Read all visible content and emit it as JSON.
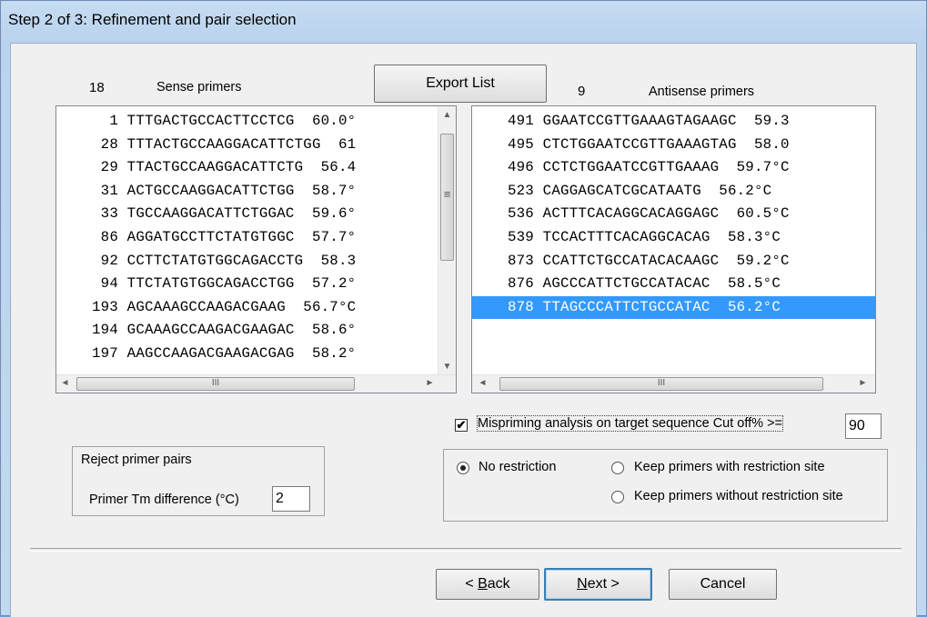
{
  "window": {
    "title": "Step 2 of 3:  Refinement and pair selection"
  },
  "sense": {
    "count": "18",
    "label": "Sense primers",
    "rows": [
      "1 TTTGACTGCCACTTCCTCG  60.0°",
      "28 TTTACTGCCAAGGACATTCTGG  61",
      "29 TTACTGCCAAGGACATTCTG  56.4",
      "31 ACTGCCAAGGACATTCTGG  58.7°",
      "33 TGCCAAGGACATTCTGGAC  59.6°",
      "86 AGGATGCCTTCTATGTGGC  57.7°",
      "92 CCTTCTATGTGGCAGACCTG  58.3",
      "94 TTCTATGTGGCAGACCTGG  57.2°",
      "193 AGCAAAGCCAAGACGAAG  56.7°C",
      "194 GCAAAGCCAAGACGAAGAC  58.6°",
      "197 AAGCCAAGACGAAGACGAG  58.2°"
    ]
  },
  "export_label": "Export List",
  "antisense": {
    "count": "9",
    "label": "Antisense primers",
    "selected_index": 8,
    "rows": [
      "491 GGAATCCGTTGAAAGTAGAAGC  59.3",
      "495 CTCTGGAATCCGTTGAAAGTAG  58.0",
      "496 CCTCTGGAATCCGTTGAAAG  59.7°C",
      "523 CAGGAGCATCGCATAATG  56.2°C",
      "536 ACTTTCACAGGCACAGGAGC  60.5°C",
      "539 TCCACTTTCACAGGCACAG  58.3°C",
      "873 CCATTCTGCCATACACAAGC  59.2°C",
      "876 AGCCCATTCTGCCATACAC  58.5°C",
      "878 TTAGCCCATTCTGCCATAC  56.2°C"
    ]
  },
  "mispriming": {
    "checked": true,
    "label": "Mispriming analysis on target sequence  Cut off% >=",
    "cutoff": "90"
  },
  "reject": {
    "title": "Reject primer pairs",
    "tm_label": "Primer Tm difference (°C)",
    "tm_value": "2"
  },
  "restriction": {
    "selected": "No restriction",
    "options": [
      "No restriction",
      "Keep primers with restriction site",
      "Keep primers without restriction site"
    ]
  },
  "buttons": {
    "back": "< Back",
    "next": "Next >",
    "cancel": "Cancel"
  },
  "scroll_glyphs": {
    "up": "▲",
    "down": "▼",
    "left": "◄",
    "right": "►",
    "grip": "III",
    "vgrip": "≡"
  }
}
